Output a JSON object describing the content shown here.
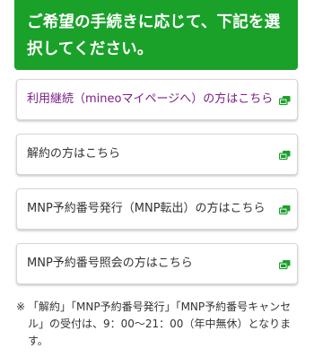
{
  "header": {
    "title": "ご希望の手続きに応じて、下記を選択してください。"
  },
  "options": [
    {
      "label": "利用継続（mineoマイページへ）の方はこちら",
      "icon": "external-link-icon"
    },
    {
      "label": "解約の方はこちら",
      "icon": "external-link-icon"
    },
    {
      "label": "MNP予約番号発行（MNP転出）の方はこちら",
      "icon": "external-link-icon"
    },
    {
      "label": "MNP予約番号照会の方はこちら",
      "icon": "external-link-icon"
    }
  ],
  "note": {
    "mark": "※",
    "text": "「解約」「MNP予約番号発行」「MNP予約番号キャンセル」の受付は、9：00〜21：00（年中無休）となります。"
  },
  "colors": {
    "header_bg": "#1aa12a",
    "visited_link": "#7b1f86",
    "icon": "#1aa12a"
  }
}
